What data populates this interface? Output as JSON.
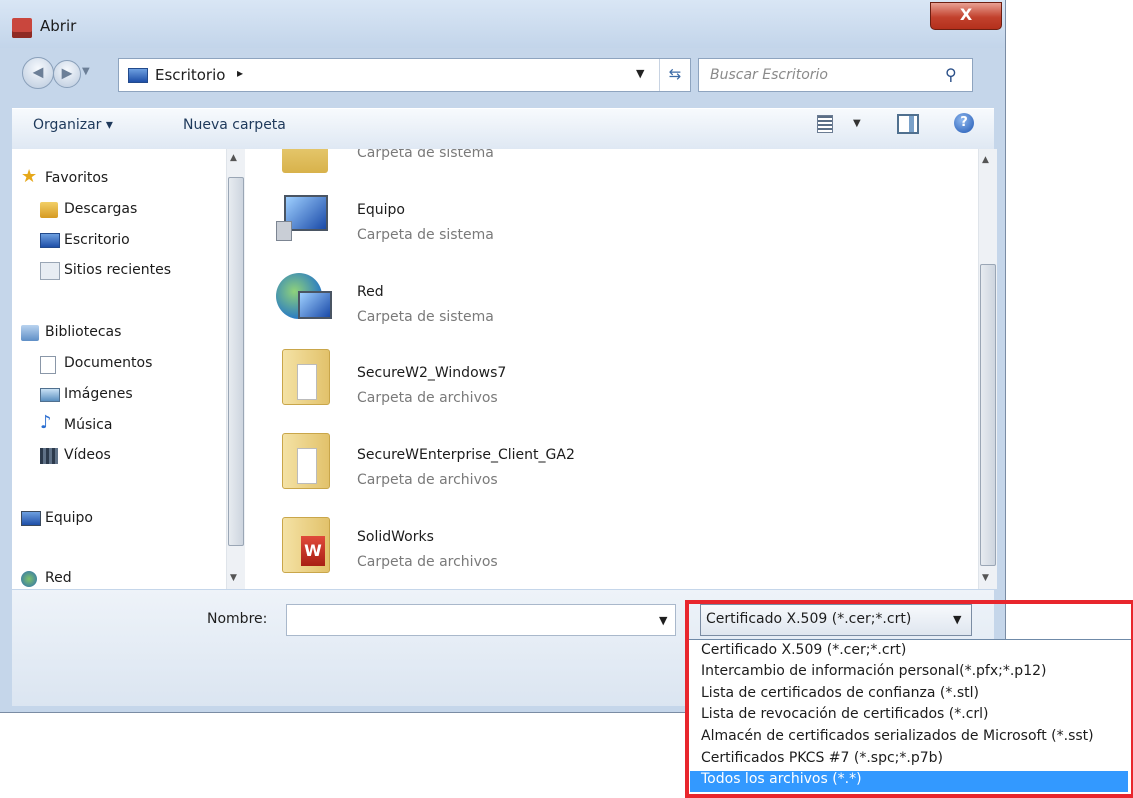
{
  "window": {
    "title": "Abrir",
    "close_label": "X"
  },
  "address_bar": {
    "location": "Escritorio",
    "separator": "▸",
    "refresh_icon": "refresh-icon",
    "search_placeholder": "Buscar Escritorio"
  },
  "toolbar": {
    "organize_label": "Organizar ▾",
    "new_folder_label": "Nueva carpeta",
    "help_label": "?"
  },
  "sidebar": {
    "groups": [
      {
        "label": "Favoritos",
        "items": [
          "Descargas",
          "Escritorio",
          "Sitios recientes"
        ]
      },
      {
        "label": "Bibliotecas",
        "items": [
          "Documentos",
          "Imágenes",
          "Música",
          "Vídeos"
        ]
      },
      {
        "label": "Equipo",
        "items": []
      },
      {
        "label": "Red",
        "items": []
      }
    ]
  },
  "files": {
    "partial_top_type": "Carpeta de sistema",
    "items": [
      {
        "name": "Equipo",
        "type": "Carpeta de sistema"
      },
      {
        "name": "Red",
        "type": "Carpeta de sistema"
      },
      {
        "name": "SecureW2_Windows7",
        "type": "Carpeta de archivos"
      },
      {
        "name": "SecureWEnterprise_Client_GA2",
        "type": "Carpeta de archivos"
      },
      {
        "name": "SolidWorks",
        "type": "Carpeta de archivos"
      }
    ]
  },
  "bottom": {
    "name_label": "Nombre:",
    "name_value": "",
    "file_type_selected": "Certificado X.509 (*.cer;*.crt)",
    "file_type_options": [
      "Certificado X.509 (*.cer;*.crt)",
      "Intercambio de información personal(*.pfx;*.p12)",
      "Lista de certificados de confianza (*.stl)",
      "Lista de revocación de certificados (*.crl)",
      "Almacén de certificados serializados de Microsoft (*.sst)",
      "Certificados PKCS #7 (*.spc;*.p7b)",
      "Todos los archivos (*.*)"
    ],
    "highlighted_option_index": 6
  },
  "colors": {
    "highlight_box": "#e8262d",
    "selection": "#3399ff"
  }
}
